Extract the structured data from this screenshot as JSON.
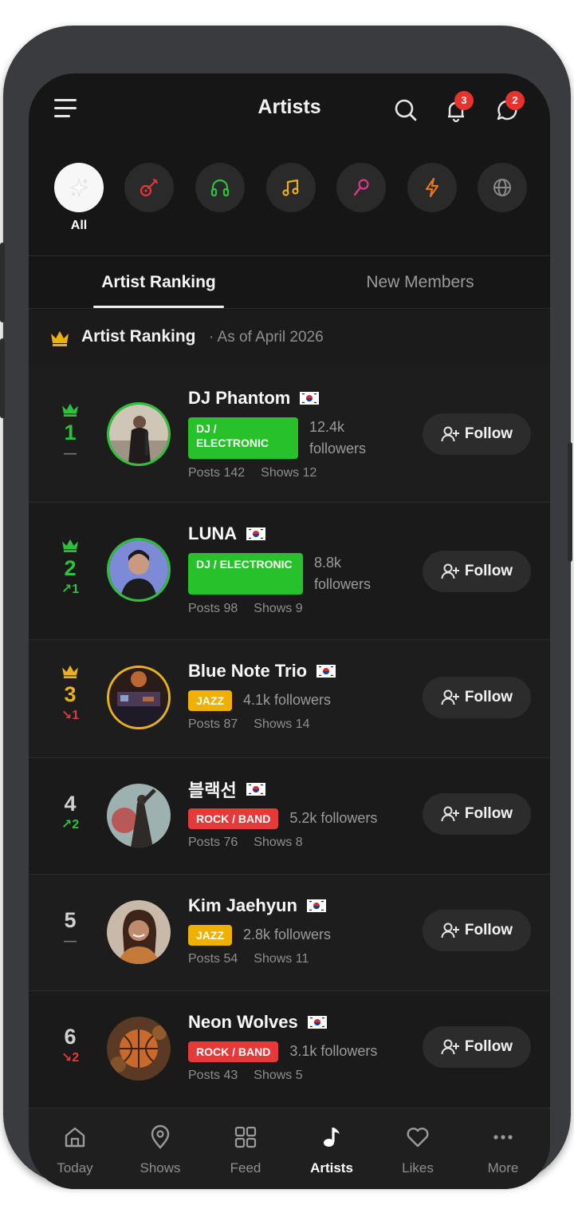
{
  "header": {
    "title": "Artists",
    "notifications_count": "3",
    "messages_count": "2"
  },
  "categories": [
    {
      "id": "all",
      "icon": "sparkle-icon",
      "label": "All",
      "active": true
    },
    {
      "id": "guitar",
      "icon": "guitar-icon",
      "color": "#e0383c"
    },
    {
      "id": "headphones",
      "icon": "headphones-icon",
      "color": "#2ec23a"
    },
    {
      "id": "music",
      "icon": "music-note-icon",
      "color": "#e8b11a"
    },
    {
      "id": "mic",
      "icon": "microphone-icon",
      "color": "#e0378e"
    },
    {
      "id": "bolt",
      "icon": "lightning-icon",
      "color": "#e9741f"
    },
    {
      "id": "globe",
      "icon": "globe-icon",
      "color": "#8a8a8a"
    }
  ],
  "tabs": [
    {
      "label": "Artist Ranking",
      "active": true
    },
    {
      "label": "New Members",
      "active": false
    }
  ],
  "section": {
    "title": "Artist Ranking",
    "subtitle": "· As of April 2026"
  },
  "artists": [
    {
      "rank": "1",
      "crown": true,
      "change": "—",
      "change_dir": "none",
      "name": "DJ Phantom",
      "genre": "DJ / ELECTRONIC",
      "genre_type": "dj",
      "followers": "12.4k followers",
      "posts": "Posts 142",
      "shows": "Shows 12",
      "ring": "#2ec23a",
      "follow": "Follow"
    },
    {
      "rank": "2",
      "crown": true,
      "change": "1",
      "change_dir": "up",
      "name": "LUNA",
      "genre": "DJ / ELECTRONIC",
      "genre_type": "dj",
      "followers": "8.8k followers",
      "posts": "Posts 98",
      "shows": "Shows 9",
      "ring": "#2ec23a",
      "follow": "Follow"
    },
    {
      "rank": "3",
      "crown": true,
      "change": "1",
      "change_dir": "down",
      "name": "Blue Note Trio",
      "genre": "JAZZ",
      "genre_type": "jazz",
      "followers": "4.1k followers",
      "posts": "Posts 87",
      "shows": "Shows 14",
      "ring": "#e8b11a",
      "follow": "Follow"
    },
    {
      "rank": "4",
      "crown": false,
      "change": "2",
      "change_dir": "up",
      "name": "블랙선",
      "genre": "ROCK / BAND",
      "genre_type": "rock",
      "followers": "5.2k followers",
      "posts": "Posts 76",
      "shows": "Shows 8",
      "ring": "",
      "follow": "Follow"
    },
    {
      "rank": "5",
      "crown": false,
      "change": "—",
      "change_dir": "none",
      "name": "Kim Jaehyun",
      "genre": "JAZZ",
      "genre_type": "jazz",
      "followers": "2.8k followers",
      "posts": "Posts 54",
      "shows": "Shows 11",
      "ring": "",
      "follow": "Follow"
    },
    {
      "rank": "6",
      "crown": false,
      "change": "2",
      "change_dir": "down",
      "name": "Neon Wolves",
      "genre": "ROCK / BAND",
      "genre_type": "rock",
      "followers": "3.1k followers",
      "posts": "Posts 43",
      "shows": "Shows 5",
      "ring": "",
      "follow": "Follow"
    }
  ],
  "bottom_nav": [
    {
      "label": "Today",
      "icon": "home-icon",
      "active": false
    },
    {
      "label": "Shows",
      "icon": "map-pin-icon",
      "active": false
    },
    {
      "label": "Feed",
      "icon": "grid-icon",
      "active": false
    },
    {
      "label": "Artists",
      "icon": "music-note-icon",
      "active": true
    },
    {
      "label": "Likes",
      "icon": "heart-icon",
      "active": false
    },
    {
      "label": "More",
      "icon": "more-dots-icon",
      "active": false
    }
  ],
  "colors": {
    "rank_gold": "#e8b11a",
    "rank_green": "#2ec23a",
    "up": "#2ec23a",
    "down": "#e53935"
  }
}
